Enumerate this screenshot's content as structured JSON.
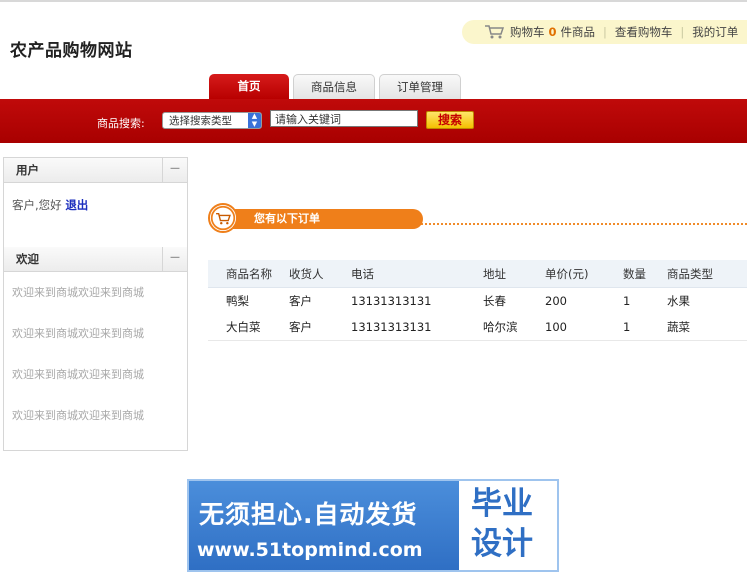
{
  "site": {
    "title": "农产品购物网站"
  },
  "cart": {
    "label": "购物车",
    "count": "0",
    "unit": "件商品",
    "view_link": "查看购物车",
    "my_link": "我的订单"
  },
  "nav": {
    "tabs": [
      {
        "label": "首页",
        "active": true
      },
      {
        "label": "商品信息",
        "active": false
      },
      {
        "label": "订单管理",
        "active": false
      }
    ]
  },
  "search": {
    "label": "商品搜索:",
    "select_value": "选择搜索类型",
    "input_value": "请输入关键词",
    "button_label": "搜索"
  },
  "sidebar": {
    "user_panel": {
      "title": "用户",
      "collapse": "—",
      "greeting": "客户,您好",
      "logout": "退出"
    },
    "welcome_panel": {
      "title": "欢迎",
      "collapse": "—",
      "lines": [
        "欢迎来到商城欢迎来到商城",
        "欢迎来到商城欢迎来到商城",
        "欢迎来到商城欢迎来到商城",
        "欢迎来到商城欢迎来到商城"
      ]
    }
  },
  "orders": {
    "banner": "您有以下订单",
    "headers": [
      "商品名称",
      "收货人",
      "电话",
      "地址",
      "单价(元)",
      "数量",
      "商品类型"
    ],
    "rows": [
      [
        "鸭梨",
        "客户",
        "13131313131",
        "长春",
        "200",
        "1",
        "水果"
      ],
      [
        "大白菜",
        "客户",
        "13131313131",
        "哈尔滨",
        "100",
        "1",
        "蔬菜"
      ]
    ]
  },
  "ad": {
    "line1": "无须担心.自动发货",
    "line2": "www.51topmind.com",
    "logo_line1": "毕业",
    "logo_line2": "设计"
  },
  "colors": {
    "brand_red": "#b80000",
    "accent_orange": "#ef7f1a",
    "search_button": "#f4c000",
    "link_blue": "#1a2dbd",
    "ad_blue": "#2f6fc4"
  },
  "icons": {
    "cart": "shopping-cart-icon",
    "banner": "cart-order-icon",
    "collapse": "minus-icon",
    "select_arrow": "select-arrows-icon"
  }
}
